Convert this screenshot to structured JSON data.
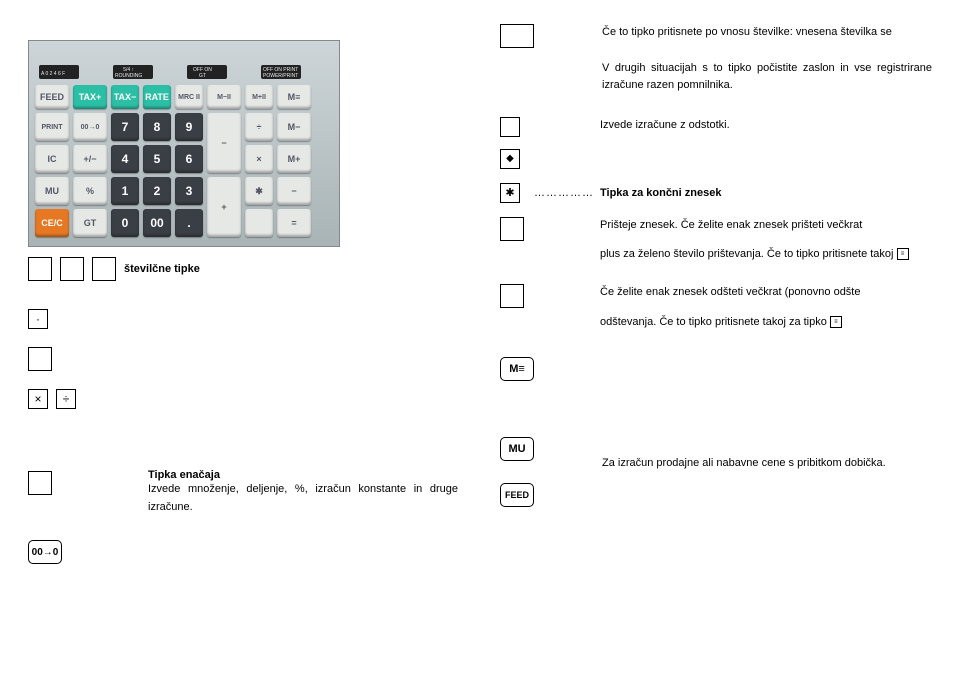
{
  "calc_top_labels": [
    "A 0 2 4 6 F",
    "5/4 ↑\nROUNDING",
    "OFF ON\nGT",
    "OFF ON PRINT\nPOWER/PRINT"
  ],
  "calc_keys": {
    "r0": [
      "FEED",
      "TAX+",
      "TAX−",
      "RATE",
      "MRC II",
      "M−II",
      "M+II",
      "M≡"
    ],
    "r1": [
      "PRINT",
      "00→0",
      "7",
      "8",
      "9",
      "−",
      "÷",
      "M−"
    ],
    "r2": [
      "IC",
      "+/−",
      "4",
      "5",
      "6",
      "",
      "×",
      "M+"
    ],
    "r3": [
      "MU",
      "%",
      "1",
      "2",
      "3",
      "+",
      "✱",
      "−"
    ],
    "r4": [
      "CE/C",
      "GT",
      "0",
      "00",
      ".",
      "",
      "",
      "="
    ]
  },
  "left": {
    "num_keys_label": "številčne tipke",
    "eq_label": "Tipka enačaja",
    "eq_desc": "Izvede množenje, deljenje, %, izračun konstante in druge izračune.",
    "dot": "·",
    "mult": "×",
    "div": "÷",
    "zerozero": "00→0"
  },
  "right": {
    "cce_desc1": "Če to tipko pritisnete po vnosu številke: vnesena številka se",
    "cce_desc2": "V drugih situacijah s to tipko počistite zaslon in vse registrirane izračune razen pomnilnika.",
    "pct_desc": "Izvede izračune z odstotki.",
    "diamond": "◆",
    "star": "✱",
    "star_dots": "……………",
    "star_label": "Tipka za končni znesek",
    "plus_desc1": "Prišteje znesek. Če želite enak znesek prišteti večkrat",
    "plus_desc2": "plus za želeno število prištevanja. Če to tipko pritisnete takoj",
    "minus_desc1": "Če želite enak znesek odšteti večkrat (ponovno odšte",
    "minus_desc2": "odštevanja. Če to tipko pritisnete takoj za tipko",
    "mrc_key": "M≡",
    "mu_key": "MU",
    "feed_key": "FEED",
    "mu_desc": "Za izračun prodajne ali nabavne cene s pribitkom dobička.",
    "tiny": "≡"
  }
}
